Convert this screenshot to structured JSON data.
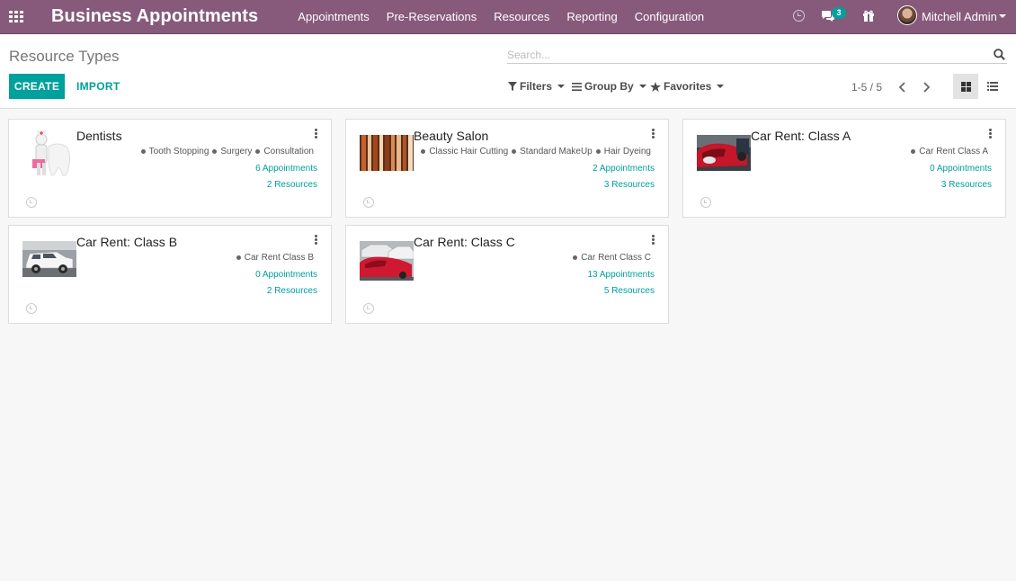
{
  "navbar": {
    "brand": "Business Appointments",
    "menu": [
      "Appointments",
      "Pre-Reservations",
      "Resources",
      "Reporting",
      "Configuration"
    ],
    "chat_badge": "3",
    "user_name": "Mitchell Admin"
  },
  "control_panel": {
    "title": "Resource Types",
    "search_placeholder": "Search...",
    "create_label": "CREATE",
    "import_label": "IMPORT",
    "filters_label": "Filters",
    "groupby_label": "Group By",
    "favorites_label": "Favorites",
    "pager": "1-5 / 5"
  },
  "cards": [
    {
      "title": "Dentists",
      "image": "dentist-tooth-icon",
      "tags": [
        "Tooth Stopping",
        "Surgery",
        "Consultation"
      ],
      "appointments": "6 Appointments",
      "resources": "2 Resources"
    },
    {
      "title": "Beauty Salon",
      "image": "hair-salon-photo",
      "tags": [
        "Classic Hair Cutting",
        "Standard MakeUp",
        "Hair Dyeing"
      ],
      "appointments": "2 Appointments",
      "resources": "3 Resources"
    },
    {
      "title": "Car Rent: Class A",
      "image": "red-car-photo",
      "tags": [
        "Car Rent Class A"
      ],
      "appointments": "0 Appointments",
      "resources": "3 Resources"
    },
    {
      "title": "Car Rent: Class B",
      "image": "white-suv-photo",
      "tags": [
        "Car Rent Class B"
      ],
      "appointments": "0 Appointments",
      "resources": "2 Resources"
    },
    {
      "title": "Car Rent: Class C",
      "image": "red-cars-lot-photo",
      "tags": [
        "Car Rent Class C"
      ],
      "appointments": "13 Appointments",
      "resources": "5 Resources"
    }
  ],
  "colors": {
    "navbar": "#875a7b",
    "accent": "#00a09d",
    "background": "#f7f7f7"
  }
}
